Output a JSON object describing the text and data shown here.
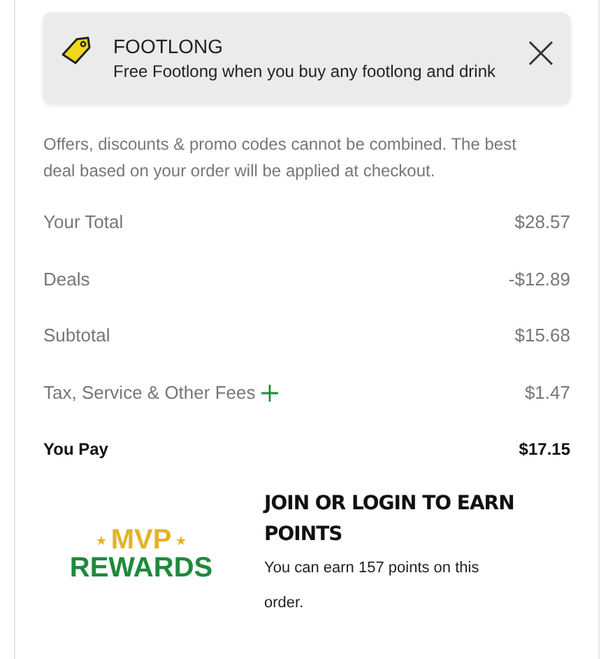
{
  "promo": {
    "title": "FOOTLONG",
    "description": "Free Footlong when you buy any footlong and drink"
  },
  "notice": "Offers, discounts & promo codes cannot be combined. The best deal based on your order will be applied at checkout.",
  "summary": [
    {
      "kind": "line",
      "label": "Your Total",
      "amount": "$28.57"
    },
    {
      "kind": "line",
      "label": "Deals",
      "amount": "-$12.89"
    },
    {
      "kind": "line",
      "label": "Subtotal",
      "amount": "$15.68"
    },
    {
      "kind": "expandable",
      "label": "Tax, Service & Other Fees",
      "amount": "$1.47",
      "expanded": false
    },
    {
      "kind": "total",
      "label": "You Pay",
      "amount": "$17.15"
    }
  ],
  "rewards": {
    "logo_top": "MVP",
    "logo_bottom": "REWARDS",
    "title": "JOIN OR LOGIN TO EARN POINTS",
    "body": "You can earn 157 points on this order."
  }
}
